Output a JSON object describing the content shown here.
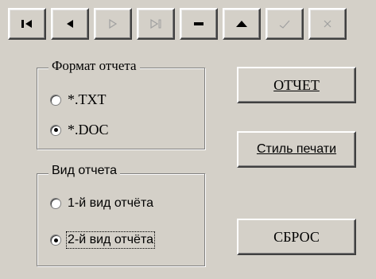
{
  "toolbar": {
    "buttons": [
      {
        "icon": "first-record-icon",
        "enabled": true
      },
      {
        "icon": "previous-record-icon",
        "enabled": true
      },
      {
        "icon": "next-record-icon",
        "enabled": false
      },
      {
        "icon": "last-record-icon",
        "enabled": false
      },
      {
        "icon": "delete-record-icon",
        "enabled": true
      },
      {
        "icon": "insert-record-icon",
        "enabled": true
      },
      {
        "icon": "post-edit-icon",
        "enabled": false
      },
      {
        "icon": "cancel-edit-icon",
        "enabled": false
      }
    ]
  },
  "report_format": {
    "title": "Формат отчета",
    "options": [
      {
        "label": "*.TXT",
        "selected": false
      },
      {
        "label": "*.DOC",
        "selected": true
      }
    ]
  },
  "report_type": {
    "title": "Вид отчета",
    "options": [
      {
        "label": "1-й вид отчёта",
        "selected": false
      },
      {
        "label": "2-й вид отчёта",
        "selected": true
      }
    ]
  },
  "buttons": {
    "report_label": "ОТЧЕТ",
    "print_style_label": "Стиль печати",
    "reset_label": "СБРОС"
  },
  "colors": {
    "face": "#d4d0c8",
    "enabled_glyph": "#000000",
    "disabled_glyph": "#a0a0a0"
  }
}
